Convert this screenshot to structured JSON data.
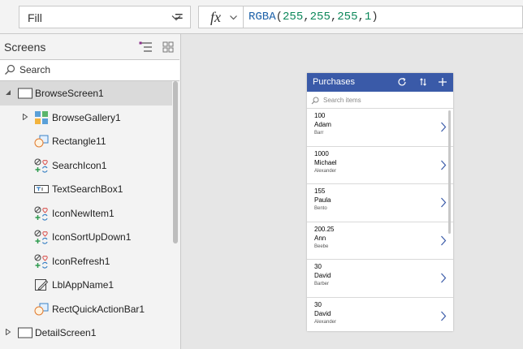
{
  "formula_bar": {
    "property": "Fill",
    "fx_label": "fx",
    "equals": "=",
    "formula": {
      "fn": "RGBA",
      "open": "(",
      "args": [
        "255",
        "255",
        "255",
        "1"
      ],
      "close": ")"
    }
  },
  "tree_panel": {
    "title": "Screens",
    "search_placeholder": "Search",
    "items": [
      {
        "label": "BrowseScreen1",
        "icon": "screen-icon"
      },
      {
        "label": "BrowseGallery1",
        "icon": "gallery-icon"
      },
      {
        "label": "Rectangle11",
        "icon": "rectangle-icon"
      },
      {
        "label": "SearchIcon1",
        "icon": "icons-control-icon"
      },
      {
        "label": "TextSearchBox1",
        "icon": "text-input-icon"
      },
      {
        "label": "IconNewItem1",
        "icon": "icons-control-icon"
      },
      {
        "label": "IconSortUpDown1",
        "icon": "icons-control-icon"
      },
      {
        "label": "IconRefresh1",
        "icon": "icons-control-icon"
      },
      {
        "label": "LblAppName1",
        "icon": "label-icon"
      },
      {
        "label": "RectQuickActionBar1",
        "icon": "rectangle-icon"
      },
      {
        "label": "DetailScreen1",
        "icon": "screen-icon"
      }
    ]
  },
  "app_preview": {
    "title": "Purchases",
    "search_placeholder": "Search items",
    "items": [
      {
        "line1": "100",
        "line2": "Adam",
        "line3": "Barr"
      },
      {
        "line1": "1000",
        "line2": "Michael",
        "line3": "Alexander"
      },
      {
        "line1": "155",
        "line2": "Paula",
        "line3": "Bento"
      },
      {
        "line1": "200.25",
        "line2": "Ann",
        "line3": "Beebe"
      },
      {
        "line1": "30",
        "line2": "David",
        "line3": "Barber"
      },
      {
        "line1": "30",
        "line2": "David",
        "line3": "Alexander"
      }
    ]
  },
  "colors": {
    "header_blue": "#3a5aa8",
    "accent_blue": "#3a5aa8",
    "selection": "#dadada"
  }
}
